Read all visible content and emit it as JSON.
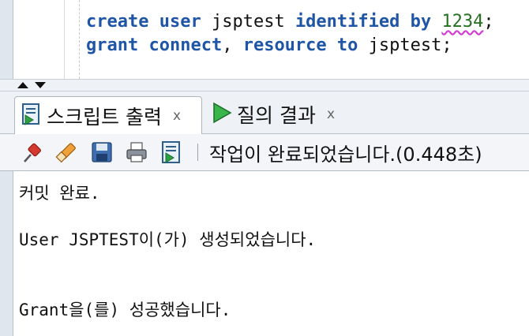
{
  "editor": {
    "line1": {
      "kw1": "create",
      "kw2": "user",
      "name": "jsptest",
      "kw3": "identified",
      "kw4": "by",
      "password": "1234",
      "end": ";"
    },
    "line2": {
      "kw1": "grant",
      "kw2": "connect",
      "comma": ",",
      "kw3": "resource",
      "kw4": "to",
      "name": "jsptest",
      "end": ";"
    }
  },
  "tabs": [
    {
      "label": "스크립트 출력",
      "close": "x",
      "icon": "script-output-icon"
    },
    {
      "label": "질의 결과",
      "close": "x",
      "icon": "run-query-icon"
    }
  ],
  "toolbar": {
    "icons": [
      "pin-icon",
      "eraser-icon",
      "save-icon",
      "print-icon",
      "script-icon"
    ],
    "status": "작업이 완료되었습니다.(0.448초)"
  },
  "output": [
    "커밋 완료.",
    "User JSPTEST이(가) 생성되었습니다.",
    "Grant을(를) 성공했습니다."
  ],
  "colors": {
    "keyword": "#1f55a6",
    "number": "#257021",
    "spellcheck": "#d23ad2"
  }
}
